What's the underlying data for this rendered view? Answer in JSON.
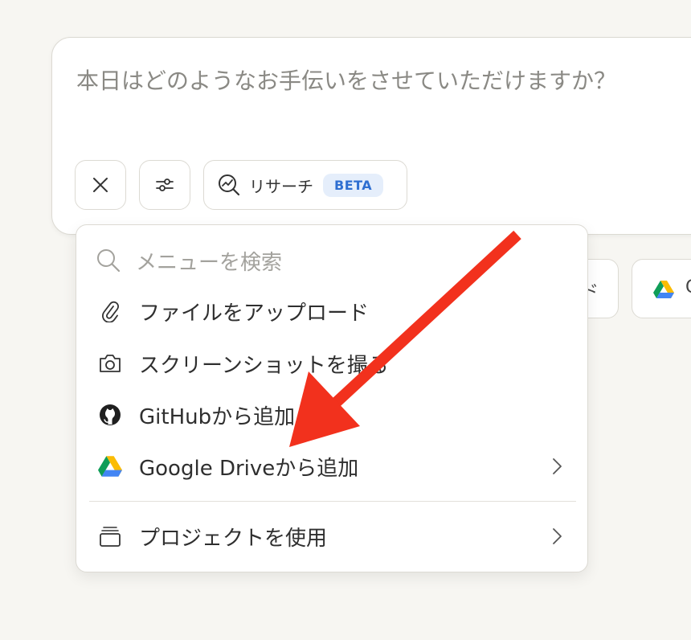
{
  "composer": {
    "placeholder": "本日はどのようなお手伝いをさせていただけますか？",
    "research_label": "リサーチ",
    "beta_label": "BETA"
  },
  "background_chips": {
    "partial_glyph": "ド",
    "partial_text": "G"
  },
  "menu": {
    "search_placeholder": "メニューを検索",
    "items": [
      {
        "label": "ファイルをアップロード",
        "icon": "paperclip-icon"
      },
      {
        "label": "スクリーンショットを撮る",
        "icon": "camera-icon"
      },
      {
        "label": "GitHubから追加",
        "icon": "github-icon"
      },
      {
        "label": "Google Driveから追加",
        "icon": "google-drive-icon",
        "has_submenu": true
      },
      {
        "label": "プロジェクトを使用",
        "icon": "project-icon",
        "has_submenu": true
      }
    ]
  },
  "annotation": {
    "arrow_color": "#f2311d"
  }
}
